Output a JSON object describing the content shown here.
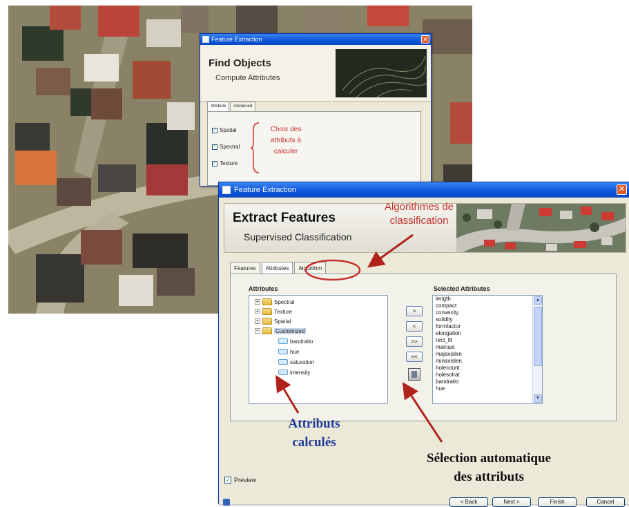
{
  "find_objects_window": {
    "title": "Feature Extraction",
    "close_glyph": "✕",
    "banner_title": "Find Objects",
    "banner_subtitle": "Compute Attributes",
    "tabs": [
      "Attribute",
      "Advanced"
    ],
    "checkboxes": [
      {
        "label": "Spatial",
        "checked": true
      },
      {
        "label": "Spectral",
        "checked": true
      },
      {
        "label": "Texture",
        "checked": true
      }
    ],
    "note": [
      "Choix des",
      "attributs à",
      "calculer"
    ]
  },
  "extract_window": {
    "title": "Feature Extraction",
    "close_glyph": "✕",
    "banner_title": "Extract Features",
    "banner_subtitle": "Supervised Classification",
    "tabs": [
      "Features",
      "Attributes",
      "Algorithm"
    ],
    "active_tab": "Attributes",
    "attributes_label": "Attributes",
    "selected_label": "Selected Attributes",
    "tree": [
      {
        "label": "Spectral",
        "expander": "+"
      },
      {
        "label": "Texture",
        "expander": "+"
      },
      {
        "label": "Spatial",
        "expander": "+"
      },
      {
        "label": "Customized",
        "expander": "−"
      }
    ],
    "customized_children": [
      "bandratio",
      "hue",
      "saturation",
      "intensity"
    ],
    "move_buttons": [
      ">",
      "<",
      ">>",
      "<<"
    ],
    "selected_attributes": [
      "length",
      "compact",
      "convexity",
      "solidity",
      "formfactor",
      "elongation",
      "rect_fit",
      "mainaxi",
      "majaxislen",
      "minaxislen",
      "holecount",
      "holesolrat",
      "bandratio",
      "hue"
    ],
    "preview_label": "Preview",
    "bottom_buttons": [
      "< Back",
      "Next >",
      "Finish",
      "Cancel"
    ]
  },
  "annotations": {
    "algo": [
      "Algorithmes de",
      "classification"
    ],
    "attrib": [
      "Attributs",
      "calculés"
    ],
    "auto": [
      "Sélection automatique",
      "des attributs"
    ]
  },
  "colors": {
    "annotation_red": "#c4302b",
    "annotation_blue": "#1f3a98",
    "xp_title_blue": "#0b55d9",
    "window_bg": "#ece9d8"
  }
}
